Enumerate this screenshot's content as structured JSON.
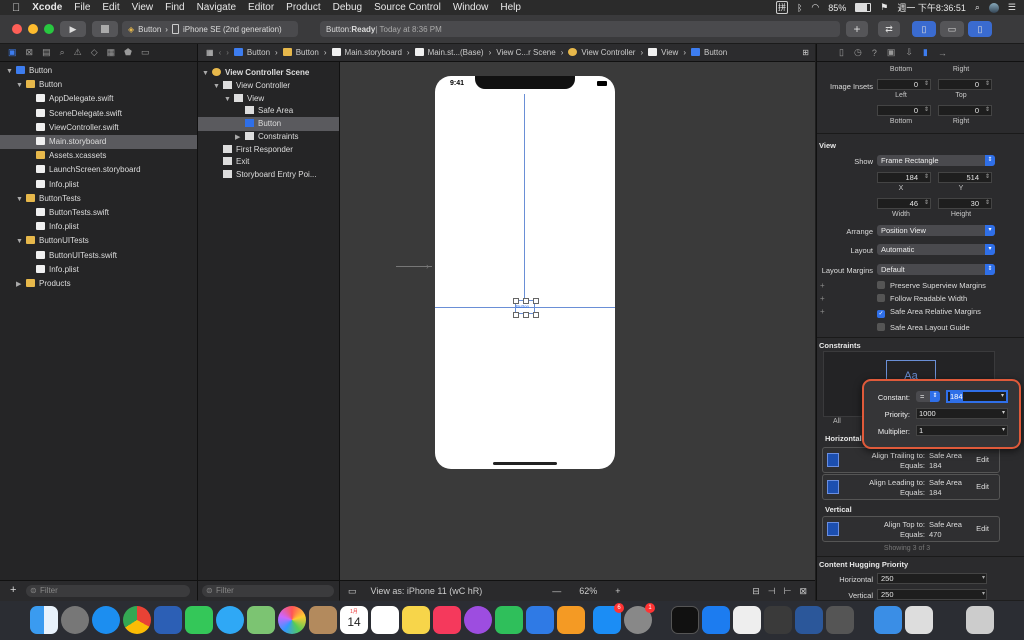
{
  "menubar": {
    "apple": "",
    "app": "Xcode",
    "items": [
      "File",
      "Edit",
      "View",
      "Find",
      "Navigate",
      "Editor",
      "Product",
      "Debug",
      "Source Control",
      "Window",
      "Help"
    ],
    "input_method": "拼",
    "battery": "85%",
    "clock": "週一 下午8:36:51"
  },
  "toolbar": {
    "scheme": "Button",
    "device": "iPhone SE (2nd generation)",
    "status_prefix": "Button: ",
    "status_state": "Ready",
    "status_time": " | Today at 8:36 PM",
    "plus": "+"
  },
  "jumpbar": [
    "Button",
    "Button",
    "Main.storyboard",
    "Main.st...(Base)",
    "View C...r Scene",
    "View Controller",
    "View",
    "Button"
  ],
  "navigator": {
    "rows": [
      {
        "label": "Button",
        "indent": 0,
        "icon": "proj",
        "tri": "▼"
      },
      {
        "label": "Button",
        "indent": 1,
        "icon": "folder",
        "tri": "▼"
      },
      {
        "label": "AppDelegate.swift",
        "indent": 2,
        "icon": "file",
        "tri": ""
      },
      {
        "label": "SceneDelegate.swift",
        "indent": 2,
        "icon": "file",
        "tri": ""
      },
      {
        "label": "ViewController.swift",
        "indent": 2,
        "icon": "file",
        "tri": ""
      },
      {
        "label": "Main.storyboard",
        "indent": 2,
        "icon": "file",
        "tri": "",
        "selected": true
      },
      {
        "label": "Assets.xcassets",
        "indent": 2,
        "icon": "folder",
        "tri": ""
      },
      {
        "label": "LaunchScreen.storyboard",
        "indent": 2,
        "icon": "file",
        "tri": ""
      },
      {
        "label": "Info.plist",
        "indent": 2,
        "icon": "file",
        "tri": ""
      },
      {
        "label": "ButtonTests",
        "indent": 1,
        "icon": "folder",
        "tri": "▼"
      },
      {
        "label": "ButtonTests.swift",
        "indent": 2,
        "icon": "file",
        "tri": ""
      },
      {
        "label": "Info.plist",
        "indent": 2,
        "icon": "file",
        "tri": ""
      },
      {
        "label": "ButtonUITests",
        "indent": 1,
        "icon": "folder",
        "tri": "▼"
      },
      {
        "label": "ButtonUITests.swift",
        "indent": 2,
        "icon": "file",
        "tri": ""
      },
      {
        "label": "Info.plist",
        "indent": 2,
        "icon": "file",
        "tri": ""
      },
      {
        "label": "Products",
        "indent": 1,
        "icon": "folder",
        "tri": "▶"
      }
    ],
    "filter_placeholder": "Filter"
  },
  "outline": {
    "title": "View Controller Scene",
    "rows": [
      {
        "label": "View Controller",
        "indent": 1,
        "tri": "▼"
      },
      {
        "label": "View",
        "indent": 2,
        "tri": "▼"
      },
      {
        "label": "Safe Area",
        "indent": 3,
        "tri": ""
      },
      {
        "label": "Button",
        "indent": 3,
        "tri": "",
        "selected": true
      },
      {
        "label": "Constraints",
        "indent": 3,
        "tri": "▶"
      },
      {
        "label": "First Responder",
        "indent": 1,
        "tri": ""
      },
      {
        "label": "Exit",
        "indent": 1,
        "tri": ""
      },
      {
        "label": "Storyboard Entry Poi...",
        "indent": 1,
        "tri": ""
      }
    ],
    "filter_placeholder": "Filter"
  },
  "canvas": {
    "phone_time": "9:41",
    "button_label": "Button",
    "view_as": "View as: iPhone 11 (wC hR)",
    "zoom": "62%",
    "minus": "—",
    "plus": "+"
  },
  "inspector": {
    "image_insets_label": "Image Insets",
    "sub_bottom": "Bottom",
    "sub_right": "Right",
    "sub_left": "Left",
    "sub_top": "Top",
    "inset_values": [
      "0",
      "0",
      "0",
      "0"
    ],
    "view_section": "View",
    "show_label": "Show",
    "show_value": "Frame Rectangle",
    "x_value": "184",
    "y_value": "514",
    "x_label": "X",
    "y_label": "Y",
    "w_value": "46",
    "h_value": "30",
    "w_label": "Width",
    "h_label": "Height",
    "arrange_label": "Arrange",
    "arrange_value": "Position View",
    "layout_label": "Layout",
    "layout_value": "Automatic",
    "margins_label": "Layout Margins",
    "margins_value": "Default",
    "checks": [
      {
        "label": "Preserve Superview Margins",
        "on": false
      },
      {
        "label": "Follow Readable Width",
        "on": false
      },
      {
        "label": "Safe Area Relative Margins",
        "on": true
      },
      {
        "label": "Safe Area Layout Guide",
        "on": false
      }
    ],
    "constraints_section": "Constraints",
    "preview_text": "Aa",
    "all_label": "All",
    "horizontal_label": "Horizontal",
    "vertical_label": "Vertical",
    "cards": [
      {
        "line1_label": "Align Trailing to:",
        "line1_value": "Safe Area",
        "line2_label": "Equals:",
        "line2_value": "184",
        "edit": "Edit"
      },
      {
        "line1_label": "Align Leading to:",
        "line1_value": "Safe Area",
        "line2_label": "Equals:",
        "line2_value": "184",
        "edit": "Edit"
      },
      {
        "line1_label": "Align Top to:",
        "line1_value": "Safe Area",
        "line2_label": "Equals:",
        "line2_value": "470",
        "edit": "Edit"
      }
    ],
    "showing": "Showing 3 of 3",
    "hugging_section": "Content Hugging Priority",
    "hugging_h_label": "Horizontal",
    "hugging_h_value": "250",
    "hugging_v_label": "Vertical",
    "hugging_v_value": "250"
  },
  "popover": {
    "constant_label": "Constant:",
    "relation": "=",
    "constant_value": "184",
    "priority_label": "Priority:",
    "priority_value": "1000",
    "multiplier_label": "Multiplier:",
    "multiplier_value": "1"
  },
  "dock": {
    "calendar_month": "1月",
    "calendar_day": "14",
    "badge_appstore": "6",
    "badge_settings": "1"
  }
}
